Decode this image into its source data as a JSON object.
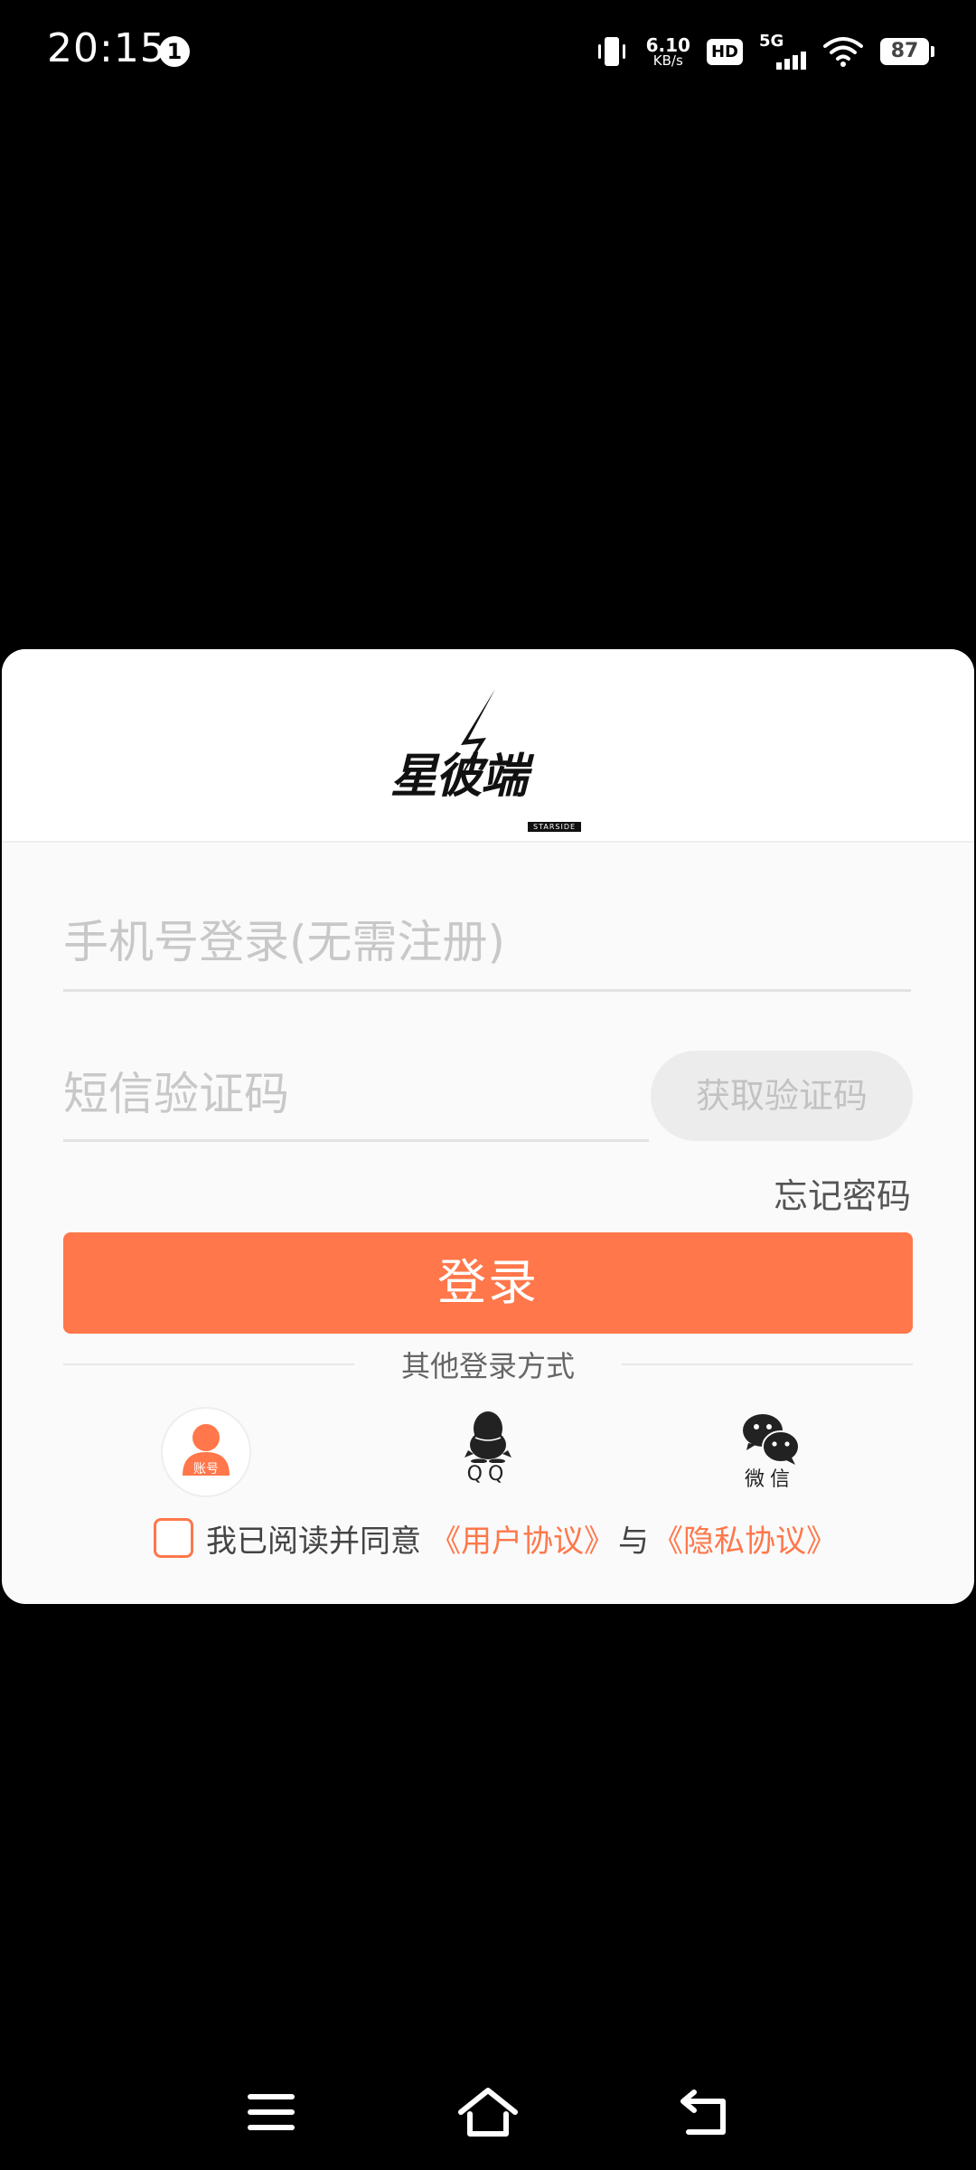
{
  "status_bar": {
    "time": "20:15",
    "notification_count": "1",
    "net_speed_value": "6.10",
    "net_speed_unit": "KB/s",
    "hd_label": "HD",
    "network_type": "5G",
    "battery_level": "87"
  },
  "logo": {
    "text": "星彼端",
    "subtext": "STARSIDE"
  },
  "form": {
    "phone_placeholder": "手机号登录(无需注册)",
    "code_placeholder": "短信验证码",
    "get_code_label": "获取验证码",
    "forgot_password_label": "忘记密码",
    "login_label": "登录"
  },
  "other_login": {
    "label": "其他登录方式",
    "account_label": "账号",
    "qq_label": "QQ",
    "wechat_label": "微信"
  },
  "agreement": {
    "prefix": "我已阅读并同意",
    "user_agreement": "《用户协议》",
    "conjunction": "与",
    "privacy_policy": "《隐私协议》",
    "checked": false
  },
  "colors": {
    "accent": "#ff774a",
    "background": "#000000",
    "card": "#fafafa"
  },
  "icons": [
    "vibrate-icon",
    "wifi-icon",
    "user-icon",
    "qq-icon",
    "wechat-icon",
    "menu-icon",
    "home-icon",
    "back-icon"
  ]
}
